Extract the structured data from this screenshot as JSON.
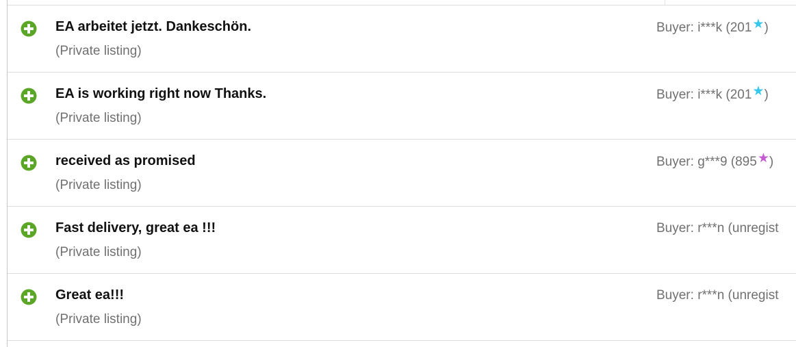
{
  "colors": {
    "positive_icon": "#5ba626",
    "star_teal": "#36c8ec",
    "star_purple": "#c55ad3",
    "title_text": "#111111",
    "muted_text": "#707070",
    "divider": "#dcdcdc"
  },
  "feedback": [
    {
      "rating_icon": "plus-circle-icon",
      "comment": "EA arbeitet jetzt. Dankeschön.",
      "item": "(Private listing)",
      "buyer_label": "Buyer: i***k (201",
      "star_color": "teal",
      "buyer_suffix": ")"
    },
    {
      "rating_icon": "plus-circle-icon",
      "comment": "EA is working right now Thanks.",
      "item": "(Private listing)",
      "buyer_label": "Buyer: i***k (201",
      "star_color": "teal",
      "buyer_suffix": ")"
    },
    {
      "rating_icon": "plus-circle-icon",
      "comment": "received as promised",
      "item": "(Private listing)",
      "buyer_label": "Buyer: g***9 (895",
      "star_color": "purple",
      "buyer_suffix": ")"
    },
    {
      "rating_icon": "plus-circle-icon",
      "comment": "Fast delivery, great ea !!!",
      "item": "(Private listing)",
      "buyer_label": "Buyer: r***n (unregist",
      "star_color": "",
      "buyer_suffix": ""
    },
    {
      "rating_icon": "plus-circle-icon",
      "comment": "Great ea!!!",
      "item": "(Private listing)",
      "buyer_label": "Buyer: r***n (unregist",
      "star_color": "",
      "buyer_suffix": ""
    }
  ],
  "star_glyph": "★"
}
